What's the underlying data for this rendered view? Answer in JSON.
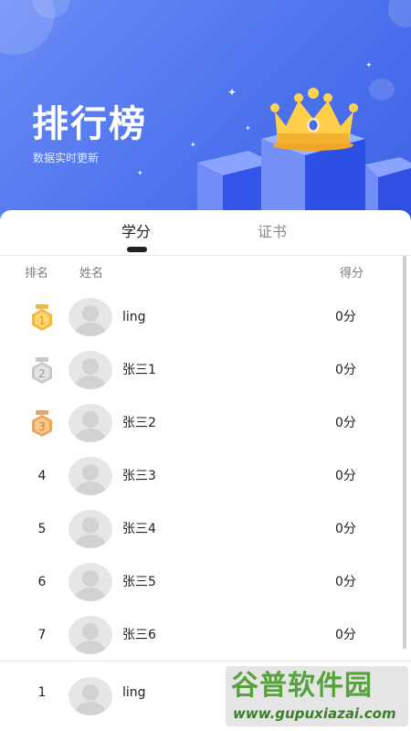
{
  "hero": {
    "title": "排行榜",
    "subtitle": "数据实时更新"
  },
  "tabs": [
    {
      "label": "学分",
      "active": true
    },
    {
      "label": "证书",
      "active": false
    }
  ],
  "columns": {
    "rank": "排名",
    "name": "姓名",
    "score": "得分"
  },
  "rows": [
    {
      "rank": "1",
      "medal": "gold",
      "name": "ling",
      "score": "0分"
    },
    {
      "rank": "2",
      "medal": "silver",
      "name": "张三1",
      "score": "0分"
    },
    {
      "rank": "3",
      "medal": "bronze",
      "name": "张三2",
      "score": "0分"
    },
    {
      "rank": "4",
      "medal": null,
      "name": "张三3",
      "score": "0分"
    },
    {
      "rank": "5",
      "medal": null,
      "name": "张三4",
      "score": "0分"
    },
    {
      "rank": "6",
      "medal": null,
      "name": "张三5",
      "score": "0分"
    },
    {
      "rank": "7",
      "medal": null,
      "name": "张三6",
      "score": "0分"
    }
  ],
  "my_rank": {
    "rank": "1",
    "name": "ling"
  },
  "watermark": {
    "line1": "谷普软件园",
    "line2": "www.gupuxiazai.com"
  },
  "colors": {
    "hero_blue": "#5277ef",
    "gold": "#f5b936",
    "silver": "#c9c9c9",
    "bronze": "#f0a35a"
  }
}
